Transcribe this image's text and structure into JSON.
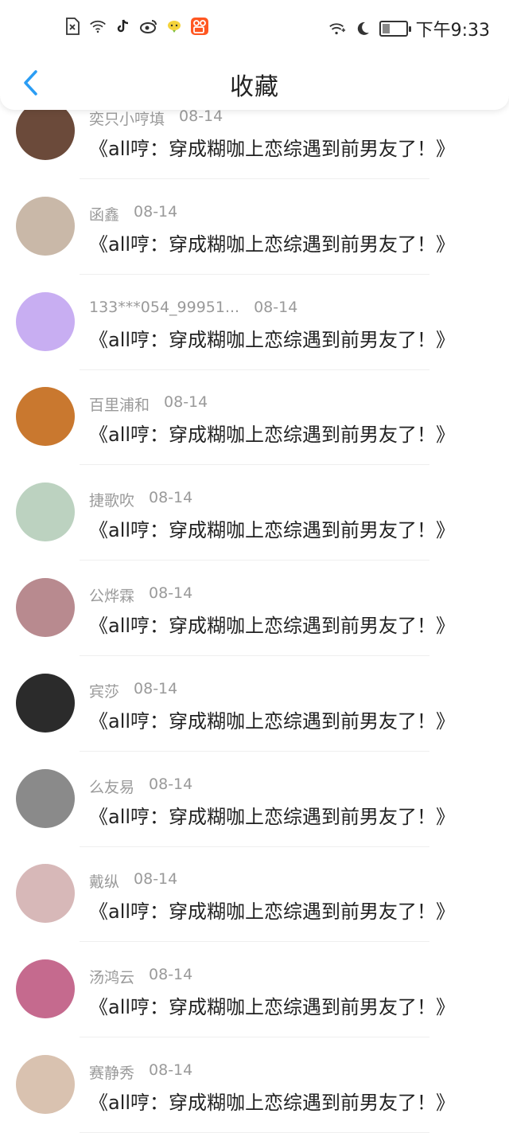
{
  "status_bar": {
    "time": "下午9:33",
    "battery_level": 0.35,
    "left_icons": [
      "sim-error-icon",
      "wifi-icon",
      "tiktok-icon",
      "weibo-icon",
      "chat-app-icon",
      "kuaishou-icon"
    ],
    "right_icons": [
      "wifi-calling-icon",
      "moon-icon",
      "battery-icon"
    ]
  },
  "header": {
    "title": "收藏",
    "back_icon": "chevron-left-icon",
    "accent_color": "#2a9df4"
  },
  "items": [
    {
      "name": "奕只小哼填",
      "date": "08-14",
      "message": "《all哼：穿成糊咖上恋综遇到前男友了！》",
      "avatar_color": "#6b4a3a"
    },
    {
      "name": "函鑫",
      "date": "08-14",
      "message": "《all哼：穿成糊咖上恋综遇到前男友了！》",
      "avatar_color": "#c9b8a8"
    },
    {
      "name": "133***054_99951...",
      "date": "08-14",
      "message": "《all哼：穿成糊咖上恋综遇到前男友了！》",
      "avatar_color": "#c8aef2"
    },
    {
      "name": "百里浦和",
      "date": "08-14",
      "message": "《all哼：穿成糊咖上恋综遇到前男友了！》",
      "avatar_color": "#c9782f"
    },
    {
      "name": "捷歌吹",
      "date": "08-14",
      "message": "《all哼：穿成糊咖上恋综遇到前男友了！》",
      "avatar_color": "#bcd2c0"
    },
    {
      "name": "公烨霖",
      "date": "08-14",
      "message": "《all哼：穿成糊咖上恋综遇到前男友了！》",
      "avatar_color": "#b88a8f"
    },
    {
      "name": "宾莎",
      "date": "08-14",
      "message": "《all哼：穿成糊咖上恋综遇到前男友了！》",
      "avatar_color": "#2b2b2b"
    },
    {
      "name": "么友易",
      "date": "08-14",
      "message": "《all哼：穿成糊咖上恋综遇到前男友了！》",
      "avatar_color": "#8a8a8a"
    },
    {
      "name": "戴纵",
      "date": "08-14",
      "message": "《all哼：穿成糊咖上恋综遇到前男友了！》",
      "avatar_color": "#d7b8b8"
    },
    {
      "name": "汤鸿云",
      "date": "08-14",
      "message": "《all哼：穿成糊咖上恋综遇到前男友了！》",
      "avatar_color": "#c56a8e"
    },
    {
      "name": "赛静秀",
      "date": "08-14",
      "message": "《all哼：穿成糊咖上恋综遇到前男友了！》",
      "avatar_color": "#d9c2b0"
    }
  ]
}
